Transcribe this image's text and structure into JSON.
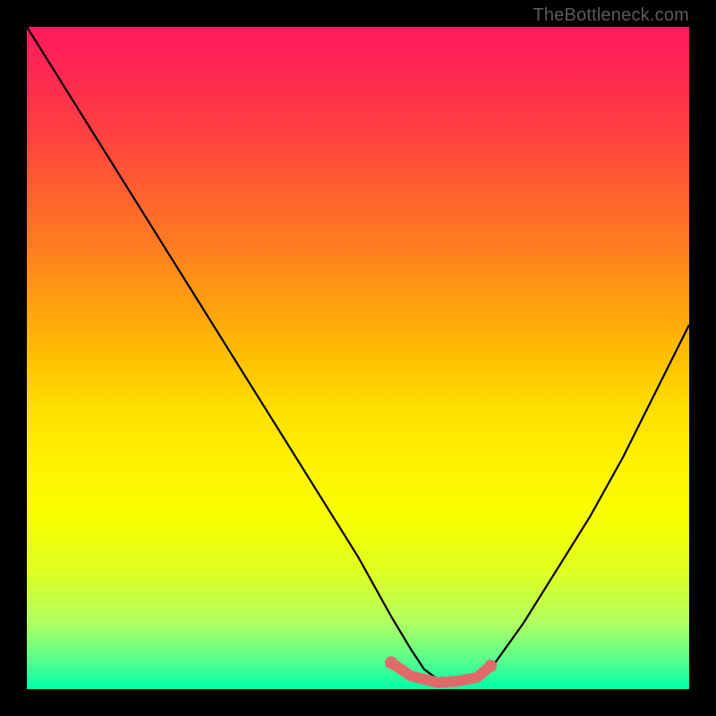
{
  "watermark": "TheBottleneck.com",
  "colors": {
    "page_bg": "#000000",
    "curve": "#000000",
    "accent_dots": "#e06a6a",
    "gradient_top": "#ff1a5e",
    "gradient_bottom": "#00ffa8"
  },
  "chart_data": {
    "type": "line",
    "title": "",
    "xlabel": "",
    "ylabel": "",
    "xlim": [
      0,
      100
    ],
    "ylim": [
      0,
      100
    ],
    "grid": false,
    "legend": false,
    "x": [
      0,
      5,
      10,
      15,
      20,
      25,
      30,
      35,
      40,
      45,
      50,
      55,
      58,
      60,
      62,
      65,
      68,
      70,
      75,
      80,
      85,
      90,
      95,
      100
    ],
    "values": [
      100,
      92,
      84,
      76,
      68,
      60,
      52,
      44,
      36,
      28,
      20,
      11,
      6,
      3,
      1.5,
      1,
      1.5,
      3,
      10,
      18,
      26,
      35,
      45,
      55
    ],
    "series": [
      {
        "name": "curve",
        "color": "#000000",
        "x": [
          0,
          5,
          10,
          15,
          20,
          25,
          30,
          35,
          40,
          45,
          50,
          55,
          58,
          60,
          62,
          65,
          68,
          70,
          75,
          80,
          85,
          90,
          95,
          100
        ],
        "values": [
          100,
          92,
          84,
          76,
          68,
          60,
          52,
          44,
          36,
          28,
          20,
          11,
          6,
          3,
          1.5,
          1,
          1.5,
          3,
          10,
          18,
          26,
          35,
          45,
          55
        ]
      },
      {
        "name": "accent-band",
        "color": "#e06a6a",
        "x": [
          55,
          58,
          60,
          62,
          65,
          68,
          70
        ],
        "values": [
          4,
          2,
          1.5,
          1,
          1.2,
          1.8,
          3.5
        ]
      }
    ]
  }
}
